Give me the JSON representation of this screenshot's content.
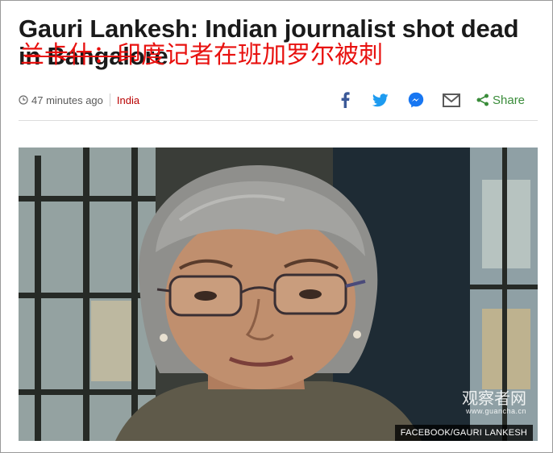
{
  "article": {
    "headline": "Gauri Lankesh: Indian journalist shot dead in Bangalore",
    "overlay_translation": "兰卡什：印度记者在班加罗尔被刺",
    "timestamp": "47 minutes ago",
    "section": "India"
  },
  "share": {
    "icons": [
      "facebook-icon",
      "twitter-icon",
      "messenger-icon",
      "email-icon"
    ],
    "label": "Share"
  },
  "image": {
    "caption": "FACEBOOK/GAURI LANKESH",
    "watermark_name": "观察者网",
    "watermark_url": "www.guancha.cn"
  },
  "colors": {
    "headline": "#1a1a1a",
    "overlay_red": "#e8110f",
    "section_link": "#b80000",
    "share_blue": "#1d9bf0",
    "share_green": "#3a8c3a",
    "facebook_blue": "#3b5998"
  }
}
